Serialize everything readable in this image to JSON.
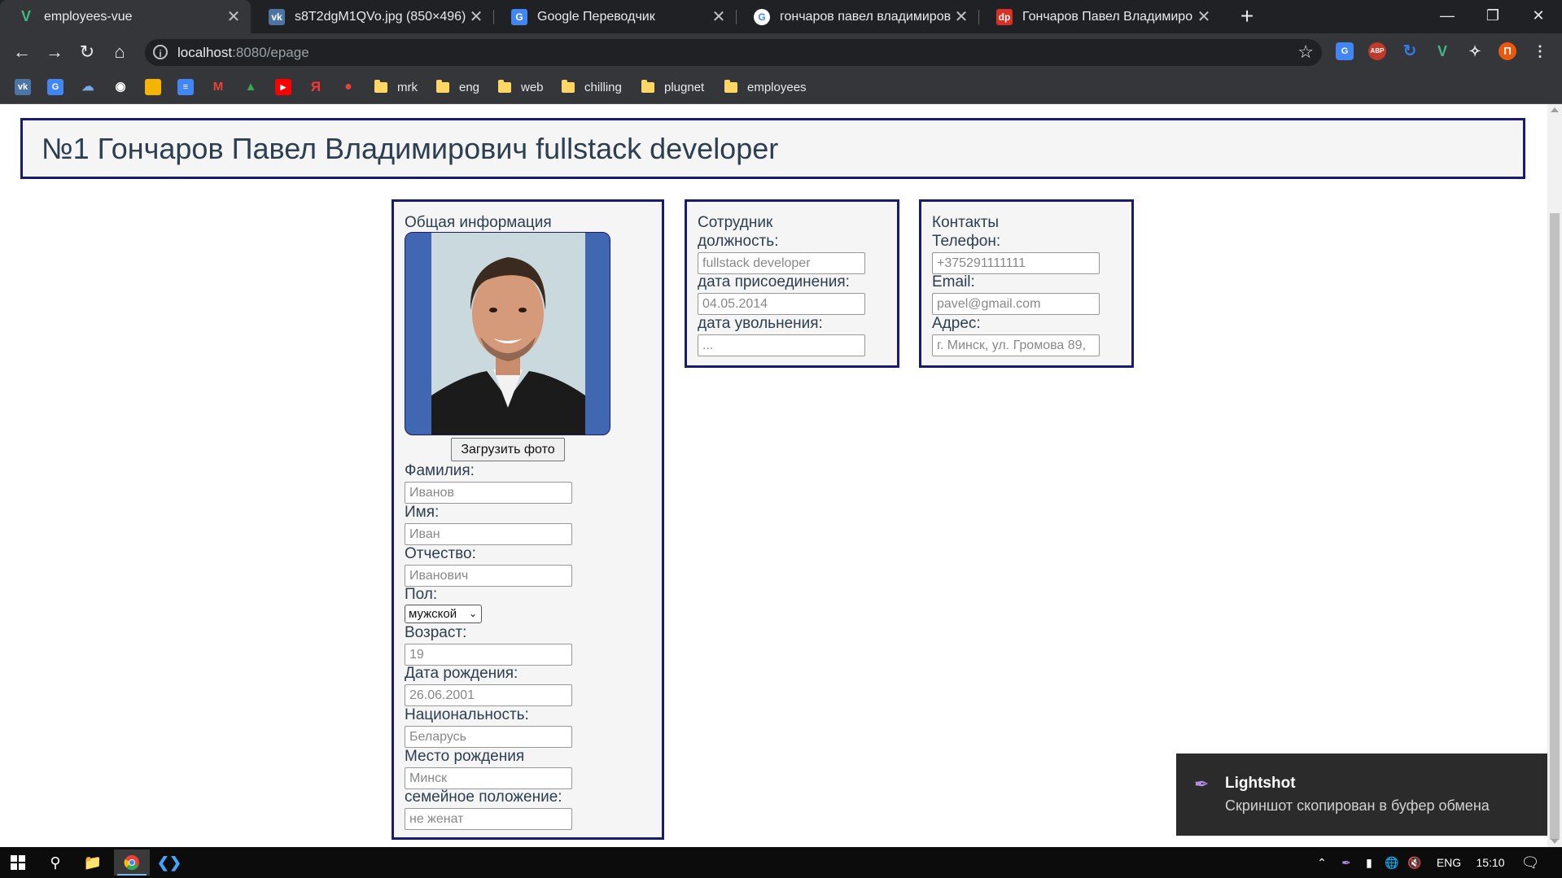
{
  "browser": {
    "tabs": [
      {
        "title": "employees-vue",
        "favicon": "V",
        "favicon_color": "#41b883",
        "active": true
      },
      {
        "title": "s8T2dgM1QVo.jpg (850×496)",
        "favicon": "vk",
        "favicon_color": "#4c75a3",
        "active": false
      },
      {
        "title": "Google Переводчик",
        "favicon": "G",
        "favicon_color": "#4285f4",
        "active": false
      },
      {
        "title": "гончаров павел владимирович",
        "favicon": "G",
        "favicon_color": "#ffffff",
        "active": false
      },
      {
        "title": "Гончаров Павел Владимирович",
        "favicon": "dp",
        "favicon_color": "#d93025",
        "active": false
      }
    ],
    "close_glyph": "✕",
    "new_tab_glyph": "+",
    "url_host": "localhost",
    "url_path": ":8080/epage",
    "bookmarks": [
      "mrk",
      "eng",
      "web",
      "chilling",
      "plugnet",
      "employees"
    ],
    "profile_initial": "П"
  },
  "page": {
    "header_title": "№1 Гончаров Павел Владимирович fullstack developer",
    "general": {
      "title": "Общая информация",
      "upload_button": "Загрузить фото",
      "surname_label": "Фамилия:",
      "surname_placeholder": "Иванов",
      "name_label": "Имя:",
      "name_placeholder": "Иван",
      "patronymic_label": "Отчество:",
      "patronymic_placeholder": "Иванович",
      "gender_label": "Пол:",
      "gender_value": "мужской",
      "age_label": "Возраст:",
      "age_placeholder": "19",
      "birthdate_label": "Дата рождения:",
      "birthdate_placeholder": "26.06.2001",
      "nationality_label": "Национальность:",
      "nationality_placeholder": "Беларусь",
      "birthplace_label": "Место рождения",
      "birthplace_placeholder": "Минск",
      "marital_label": "семейное положение:",
      "marital_placeholder": "не женат"
    },
    "employee": {
      "title": "Сотрудник",
      "position_label": "должность:",
      "position_value": "fullstack developer",
      "join_label": "дата присоединения:",
      "join_value": "04.05.2014",
      "leave_label": "дата увольнения:",
      "leave_placeholder": "..."
    },
    "contacts": {
      "title": "Контакты",
      "phone_label": "Телефон:",
      "phone_value": "+375291111111",
      "email_label": "Email:",
      "email_value": "pavel@gmail.com",
      "address_label": "Адрес:",
      "address_value": "г. Минск, ул. Громова 89,"
    }
  },
  "toast": {
    "app": "Lightshot",
    "message": "Скриншот скопирован в буфер обмена"
  },
  "taskbar": {
    "language": "ENG",
    "time": "15:10"
  }
}
